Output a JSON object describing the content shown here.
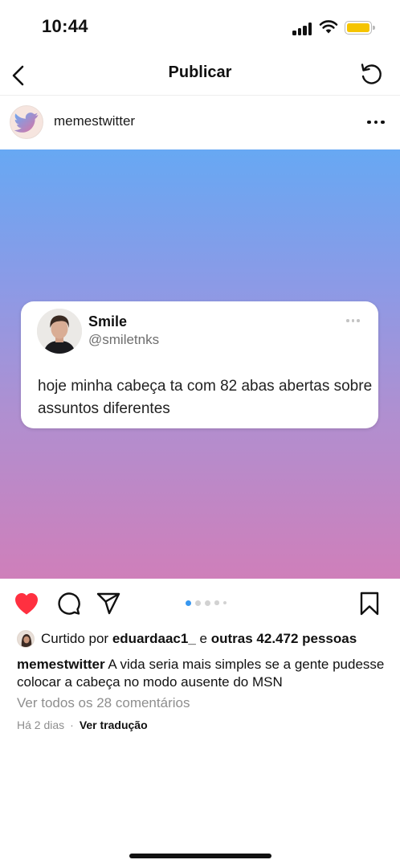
{
  "status_bar": {
    "time": "10:44",
    "battery_color": "#f5c400"
  },
  "header": {
    "title": "Publicar",
    "back_icon": "chevron-left-icon",
    "refresh_icon": "rotate-ccw-icon"
  },
  "post": {
    "username": "memestwitter",
    "avatar_icon": "bird-logo-icon",
    "more_icon": "more-horizontal-icon",
    "media_gradient": [
      "#67a8f3",
      "#8c9ae6",
      "#b08fd0",
      "#cf7fba"
    ],
    "tweet": {
      "name": "Smile",
      "handle": "@smiletnks",
      "text": "hoje minha cabeça ta com 82 abas abertas sobre assuntos diferentes"
    },
    "carousel": {
      "current": 1,
      "total": 5,
      "active_color": "#3797f0"
    },
    "actions": {
      "like_icon": "heart-filled-icon",
      "like_color": "#ff3040",
      "comment_icon": "comment-icon",
      "share_icon": "send-icon",
      "save_icon": "bookmark-icon"
    },
    "likes": {
      "prefix": "Curtido por",
      "user": "eduardaac1_",
      "conjunction": "e",
      "others": "outras 42.472 pessoas"
    },
    "caption": {
      "user": "memestwitter",
      "text": "A vida seria mais simples se a gente pudesse colocar a cabeça no modo ausente do MSN"
    },
    "comments_link": "Ver todos os 28 comentários",
    "time_ago": "Há 2 dias",
    "translate_label": "Ver tradução"
  }
}
